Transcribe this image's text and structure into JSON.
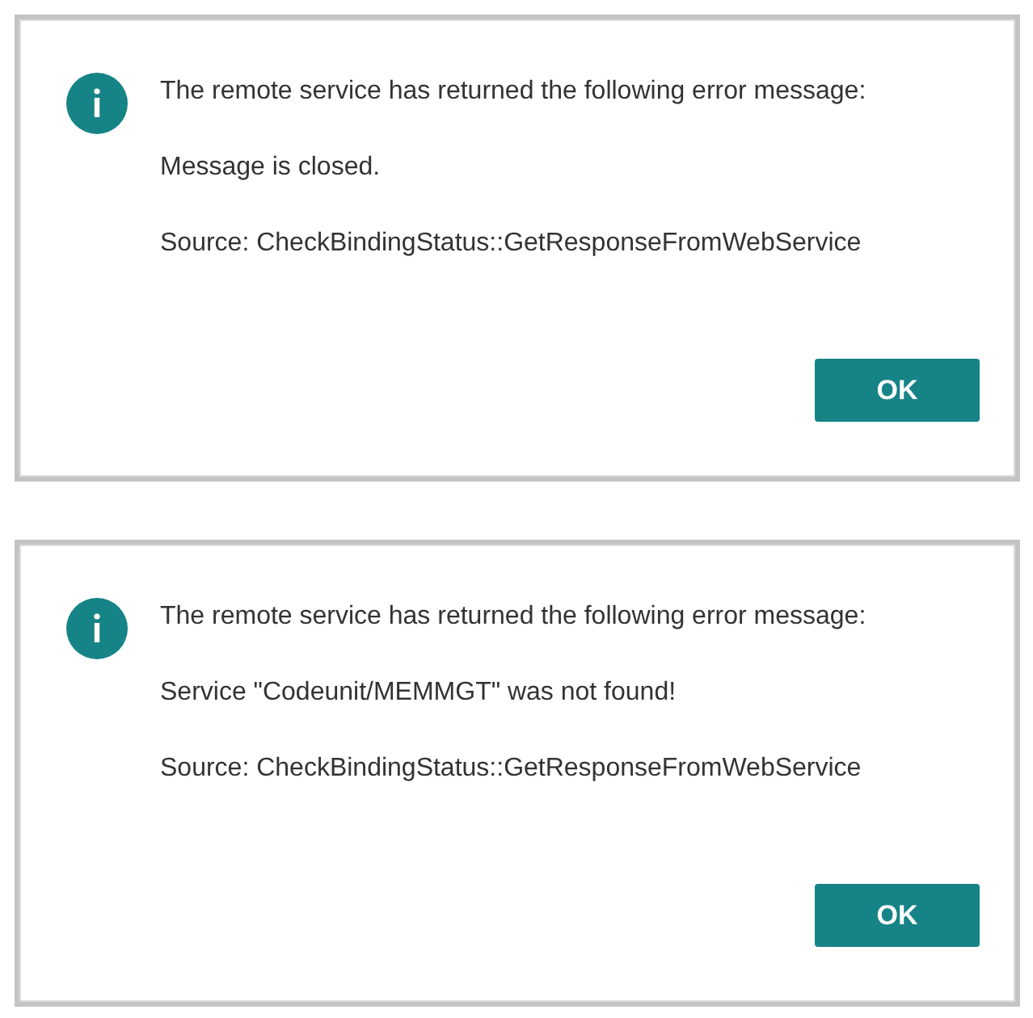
{
  "dialogs": [
    {
      "heading": "The remote service has returned the following error message:",
      "message": "Message is closed.",
      "source": "Source: CheckBindingStatus::GetResponseFromWebService",
      "button": "OK"
    },
    {
      "heading": "The remote service has returned the following error message:",
      "message": "Service \"Codeunit/MEMMGT\" was not found!",
      "source": "Source: CheckBindingStatus::GetResponseFromWebService",
      "button": "OK"
    }
  ]
}
